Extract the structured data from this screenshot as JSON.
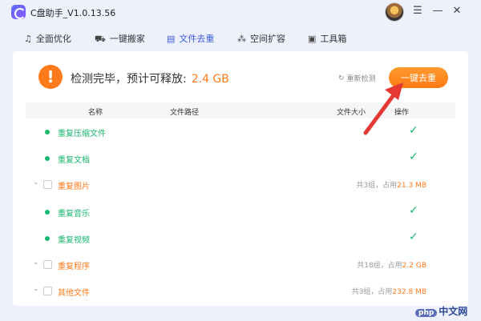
{
  "app": {
    "title": "C盘助手_V1.0.13.56"
  },
  "window": {
    "minimize": "—",
    "close": "✕"
  },
  "tabs": [
    {
      "label": "全面优化",
      "icon": "bell-icon",
      "active": false
    },
    {
      "label": "一键搬家",
      "icon": "truck-icon",
      "active": false
    },
    {
      "label": "文件去重",
      "icon": "file-icon",
      "active": true
    },
    {
      "label": "空间扩容",
      "icon": "expand-icon",
      "active": false
    },
    {
      "label": "工具箱",
      "icon": "toolbox-icon",
      "active": false
    }
  ],
  "status": {
    "icon": "!",
    "text": "检测完毕，预计可释放:",
    "size": "2.4 GB"
  },
  "actions": {
    "rescan": "重新检测",
    "rescan_icon": "↻",
    "one_click": "一键去重"
  },
  "table": {
    "headers": {
      "name": "名称",
      "path": "文件路径",
      "size": "文件大小",
      "op": "操作"
    },
    "rows": [
      {
        "type": "done",
        "label": "重复压缩文件",
        "check": "✓"
      },
      {
        "type": "done",
        "label": "重复文档",
        "check": "✓"
      },
      {
        "type": "group",
        "label": "重复图片",
        "chev": "⌄",
        "summary_pre": "共3组，占用",
        "summary_size": "21.3 MB"
      },
      {
        "type": "done",
        "label": "重复音乐",
        "check": "✓"
      },
      {
        "type": "done",
        "label": "重复视频",
        "check": "✓"
      },
      {
        "type": "group",
        "label": "重复程序",
        "chev": "⌄",
        "summary_pre": "共18组，占用",
        "summary_size": "2.2 GB"
      },
      {
        "type": "group",
        "label": "其他文件",
        "chev": "⌄",
        "summary_pre": "共3组，占用",
        "summary_size": "232.8 MB"
      }
    ]
  },
  "watermark": {
    "badge": "php",
    "text": "中文网"
  },
  "colors": {
    "accent": "#ff7a1a",
    "success": "#18b86e",
    "tab_active": "#3a5bd9",
    "annotation": "#e53935"
  }
}
